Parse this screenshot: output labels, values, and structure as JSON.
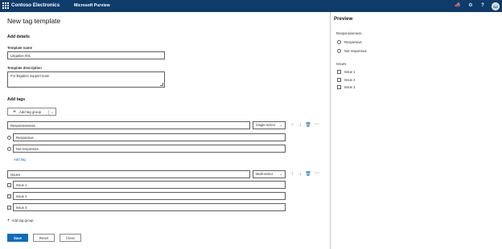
{
  "header": {
    "org_name": "Contoso Electronics",
    "app_name": "Microsoft Purview",
    "avatar_initials": "NA",
    "brand_color": "#0f3b6b",
    "icons": [
      "waffle-icon",
      "megaphone-icon",
      "gear-icon",
      "help-icon"
    ]
  },
  "page": {
    "title": "New tag template",
    "details_heading": "Add details",
    "template_name_label": "Template name",
    "template_name_value": "Litigation 001",
    "template_description_label": "Template description",
    "template_description_value": "For litigation support team",
    "tags_heading": "Add tags",
    "add_tag_group_button": "Add tag group",
    "add_tag_link": "Add tag",
    "add_tag_group_link": "Add tag group"
  },
  "tag_groups": [
    {
      "name": "Responsiveness",
      "type": "Single-select",
      "control": "radio",
      "tags": [
        "Responsive",
        "Not responsive"
      ]
    },
    {
      "name": "Issues",
      "type": "Multi-select",
      "control": "checkbox",
      "tags": [
        "Issue 1",
        "Issue 2",
        "Issue 3"
      ]
    }
  ],
  "footer": {
    "save": "Save",
    "reset": "Reset",
    "close": "Close"
  },
  "preview": {
    "title": "Preview",
    "groups": [
      {
        "name": "Responsiveness",
        "options": [
          "Responsive",
          "Not responsive"
        ]
      },
      {
        "name": "Issues",
        "options": [
          "Issue 1",
          "Issue 2",
          "Issue 3"
        ]
      }
    ]
  },
  "colors": {
    "accent": "#0f6cbd",
    "border": "#605e5c"
  }
}
